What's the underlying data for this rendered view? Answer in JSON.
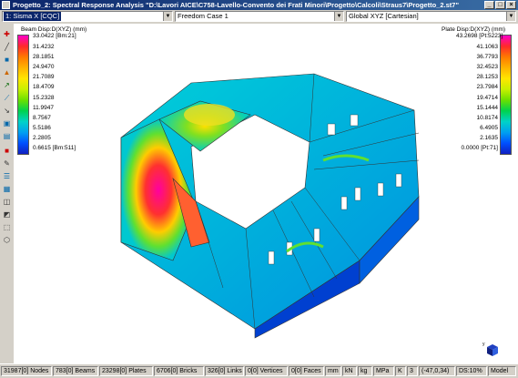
{
  "window": {
    "title": "Progetto_2: Spectral Response Analysis \"D:\\Lavori AICE\\C758-Lavello-Convento dei Frati Minori\\Progetto\\Calcoli\\Straus7\\Progetto_2.st7\""
  },
  "toolbar": {
    "result_case": "1: Sisma X [CQC]",
    "freedom_case": "Freedom Case 1",
    "coordinate_system": "Global XYZ [Cartesian]"
  },
  "tools": [
    "pointer-icon",
    "line-icon",
    "rectangle-icon",
    "zoom-icon",
    "pan-icon",
    "measure-icon",
    "node-icon",
    "filter-icon",
    "plate-icon",
    "brick-icon",
    "link-icon",
    "table-icon",
    "grid-icon",
    "cube-icon",
    "layers-icon",
    "face-icon"
  ],
  "beam_legend": {
    "title": "Beam Disp:D(XYZ) (mm)",
    "max_label": "33.0422 [Bm:21]",
    "values": [
      "31.4232",
      "28.1851",
      "24.9470",
      "21.7089",
      "18.4709",
      "15.2328",
      "11.9947",
      "8.7567",
      "5.5186",
      "2.2805"
    ],
    "min_label": "0.6615 [Bm:511]",
    "colors": [
      "#ff00c8",
      "#ff2a2a",
      "#ff7a00",
      "#ffb300",
      "#ffe600",
      "#c8f000",
      "#6be000",
      "#00d24e",
      "#00d2c8",
      "#00a0f0",
      "#0050ff",
      "#1020c0"
    ]
  },
  "plate_legend": {
    "title": "Plate Disp:D(XYZ) (mm)",
    "max_label": "43.2698 [Pt:5223]",
    "values": [
      "41.1063",
      "36.7793",
      "32.4523",
      "28.1253",
      "23.7984",
      "19.4714",
      "15.1444",
      "10.8174",
      "6.4905",
      "2.1635"
    ],
    "min_label": "0.0000 [Pt:71]",
    "colors": [
      "#ff00c8",
      "#ff2a2a",
      "#ff7a00",
      "#ffb300",
      "#ffe600",
      "#c8f000",
      "#6be000",
      "#00d24e",
      "#00d2c8",
      "#00a0f0",
      "#0050ff",
      "#1020c0"
    ]
  },
  "status": {
    "nodes": "31987[0] Nodes",
    "beams": "783[0] Beams",
    "plates": "23298[0] Plates",
    "bricks": "6706[0] Bricks",
    "links": "326[0] Links",
    "vertices": "0[0] Vertices",
    "faces": "0[0] Faces",
    "unit_length": "mm",
    "unit_force": "kN",
    "unit_mass": "kg",
    "unit_stress": "MPa",
    "unit_temp": "K",
    "value_3": "3",
    "coords": "(-47,0,34)",
    "ds": "DS:10%",
    "mode": "Model"
  }
}
